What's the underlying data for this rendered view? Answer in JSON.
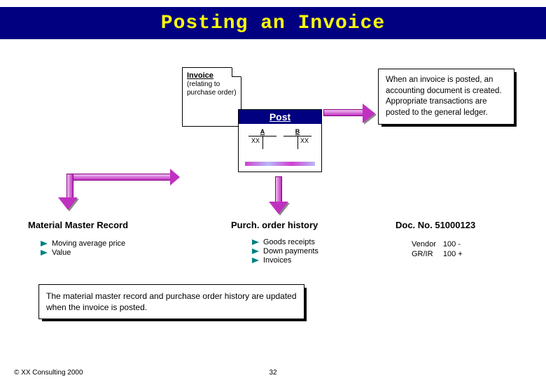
{
  "title": "Posting an Invoice",
  "invoice_doc": {
    "heading": "Invoice",
    "sub": "(relating to purchase order)"
  },
  "post": {
    "label": "Post",
    "col_a": "A",
    "col_b": "B",
    "val": "XX"
  },
  "info": "When an invoice is posted, an accounting document is created.  Appropriate transactions are posted to the general ledger.",
  "material": {
    "title": "Material Master Record",
    "items": [
      "Moving average price",
      "Value"
    ]
  },
  "po_history": {
    "title": "Purch. order history",
    "items": [
      "Goods receipts",
      "Down payments",
      "Invoices"
    ]
  },
  "doc": {
    "label": "Doc. No. 51000123",
    "rows": [
      {
        "acct": "Vendor",
        "amt": "100 -"
      },
      {
        "acct": "GR/IR",
        "amt": "100 +"
      }
    ]
  },
  "note": "The material master record and purchase order history are updated when the invoice is posted.",
  "footer": "© XX Consulting 2000",
  "page": "32"
}
